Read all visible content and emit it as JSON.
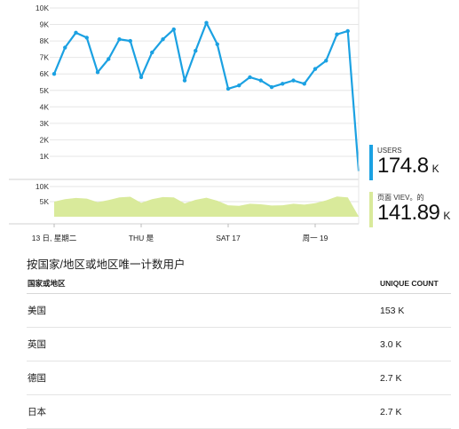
{
  "chart_data": [
    {
      "type": "line",
      "x": [
        "13 日, 星期二",
        "",
        "",
        "",
        "",
        "",
        "",
        "",
        "THU 是",
        "",
        "",
        "",
        "",
        "",
        "",
        "",
        "SAT 17",
        "",
        "",
        "",
        "",
        "",
        "",
        "",
        "周一 19",
        "",
        "",
        "",
        ""
      ],
      "series": [
        {
          "values": [
            6.0,
            7.6,
            8.5,
            8.2,
            6.1,
            6.9,
            8.1,
            8.0,
            5.8,
            7.3,
            8.1,
            8.7,
            5.6,
            7.4,
            9.1,
            7.8,
            5.1,
            5.3,
            5.8,
            5.6,
            5.2,
            5.4,
            5.6,
            5.4,
            6.3,
            6.8,
            8.4,
            8.6,
            0.1
          ]
        }
      ],
      "yticks": [
        "10K",
        "9K",
        "8K",
        "7K",
        "6K",
        "5K",
        "4K",
        "3K",
        "2K",
        "1K"
      ],
      "ylim": [
        0,
        10
      ],
      "color": "#1ba1e2",
      "grid": "horizontal"
    },
    {
      "type": "area",
      "x": [
        "13 日, 星期二",
        "",
        "",
        "",
        "",
        "",
        "",
        "",
        "THU 是",
        "",
        "",
        "",
        "",
        "",
        "",
        "",
        "SAT 17",
        "",
        "",
        "",
        "",
        "",
        "",
        "",
        "周一 19",
        "",
        "",
        "",
        ""
      ],
      "series": [
        {
          "values": [
            5.0,
            5.8,
            6.2,
            6.0,
            4.8,
            5.5,
            6.4,
            6.6,
            4.6,
            5.8,
            6.5,
            6.4,
            4.4,
            5.6,
            6.3,
            5.3,
            3.8,
            3.6,
            4.3,
            4.1,
            3.7,
            3.8,
            4.3,
            4.0,
            4.5,
            5.4,
            6.7,
            6.4,
            0.1
          ]
        }
      ],
      "yticks": [
        "10K",
        "5K"
      ],
      "ylim": [
        0,
        10
      ],
      "color": "#d9ea9b"
    }
  ],
  "xaxis": {
    "labels": [
      "13 日, 星期二",
      "THU 是",
      "SAT 17",
      "周一 19"
    ]
  },
  "metrics": {
    "users": {
      "label": "USERS",
      "value": "174.8",
      "unit": "K",
      "color": "#1ba1e2"
    },
    "page_views": {
      "label": "页面 VIEV。的",
      "value": "141.89",
      "unit": "K",
      "color": "#d9ea9b"
    }
  },
  "section_title": "按国家/地区或地区唯一计数用户",
  "table": {
    "headers": [
      "国家或地区",
      "UNIQUE COUNT"
    ],
    "rows": [
      {
        "country": "美国",
        "count": "153 K"
      },
      {
        "country": "英国",
        "count": "3.0 K"
      },
      {
        "country": "德国",
        "count": "2.7 K"
      },
      {
        "country": "日本",
        "count": "2.7 K"
      }
    ]
  }
}
